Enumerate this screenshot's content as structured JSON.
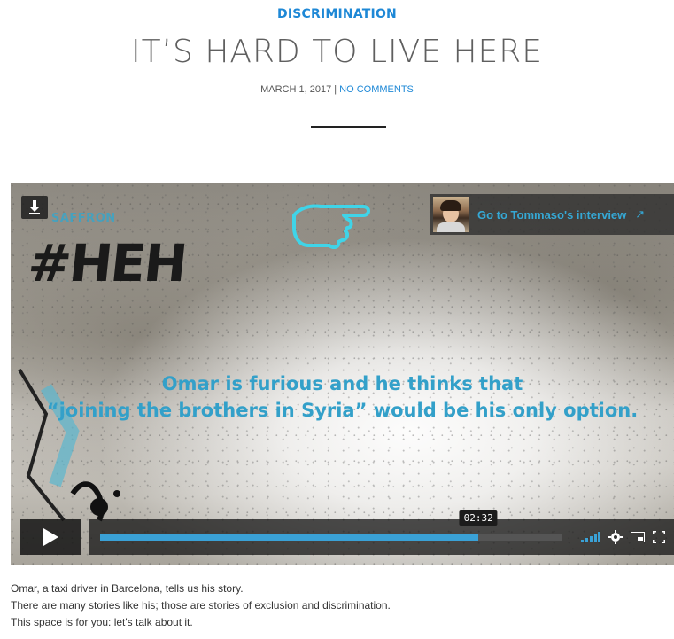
{
  "post": {
    "category": "DISCRIMINATION",
    "title": "IT’S HARD TO LIVE HERE",
    "date": "MARCH 1, 2017",
    "separator": " | ",
    "comments": "NO COMMENTS"
  },
  "video": {
    "brand": "SAFFRON",
    "graffiti": "#HEH",
    "interview_label": "Go to Tommaso's interview",
    "interview_arrow": "↗",
    "caption_line1": "Omar is furious and he thinks that",
    "caption_line2": "“joining the brothers in Syria” would be his only option.",
    "time": "02:32",
    "progress": 0.82
  },
  "body": [
    "Omar, a taxi driver in Barcelona, tells us his story.",
    "There are many stories like his; those are stories of exclusion and discrimination.",
    "This space is for you: let's talk about it."
  ],
  "colors": {
    "accent": "#1e88d6",
    "caption": "#33a0c9"
  },
  "icons": [
    "download-icon",
    "pointing-hand-icon",
    "play-icon",
    "volume-icon",
    "settings-icon",
    "pip-icon",
    "fullscreen-icon"
  ]
}
